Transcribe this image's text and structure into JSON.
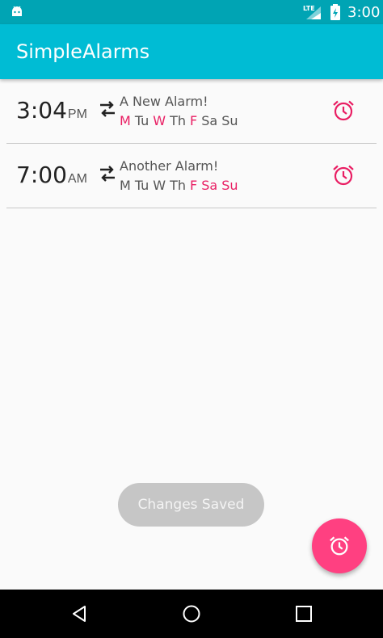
{
  "status_bar": {
    "network": "LTE",
    "time": "3:00"
  },
  "app_bar": {
    "title": "SimpleAlarms"
  },
  "alarms": [
    {
      "time": "3:04",
      "ampm": "PM",
      "name": "A New Alarm!",
      "days": [
        {
          "label": "M",
          "on": true
        },
        {
          "label": "Tu",
          "on": false
        },
        {
          "label": "W",
          "on": true
        },
        {
          "label": "Th",
          "on": false
        },
        {
          "label": "F",
          "on": true
        },
        {
          "label": "Sa",
          "on": false
        },
        {
          "label": "Su",
          "on": false
        }
      ]
    },
    {
      "time": "7:00",
      "ampm": "AM",
      "name": "Another Alarm!",
      "days": [
        {
          "label": "M",
          "on": false
        },
        {
          "label": "Tu",
          "on": false
        },
        {
          "label": "W",
          "on": false
        },
        {
          "label": "Th",
          "on": false
        },
        {
          "label": "F",
          "on": true
        },
        {
          "label": "Sa",
          "on": true
        },
        {
          "label": "Su",
          "on": true
        }
      ]
    }
  ],
  "toast": {
    "message": "Changes Saved"
  },
  "colors": {
    "primary": "#00bcd4",
    "primary_dark": "#00a4b4",
    "accent": "#ff4081",
    "day_active": "#e91e63",
    "day_inactive": "#555555"
  },
  "icons": {
    "repeat": "repeat-icon",
    "alarm": "alarm-clock-icon",
    "fab": "add-alarm-icon",
    "nav": [
      "back-icon",
      "home-icon",
      "recents-icon"
    ]
  }
}
